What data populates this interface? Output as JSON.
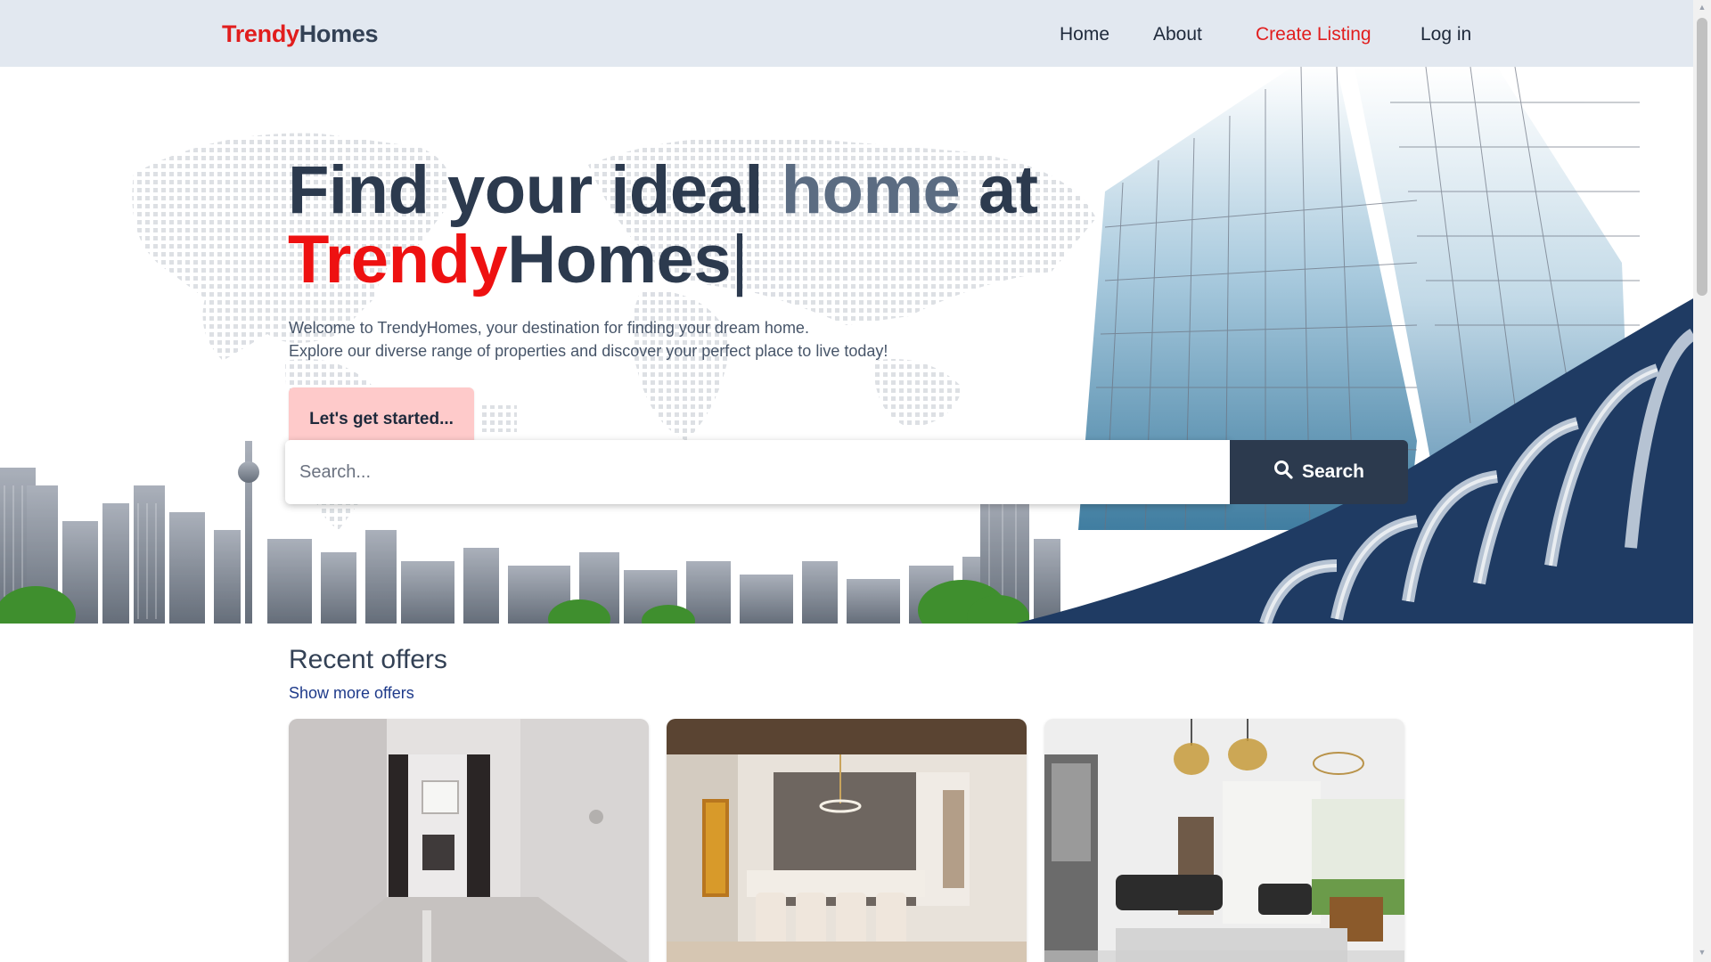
{
  "header": {
    "logo": {
      "part1": "Trendy",
      "part2": "Homes"
    },
    "nav": {
      "home": "Home",
      "about": "About",
      "create_listing": "Create Listing",
      "login": "Log in"
    }
  },
  "hero": {
    "title": {
      "line1_a": "Find your ideal ",
      "line1_b": "home",
      "line1_c": " at",
      "line2_a": "Trendy",
      "line2_b": "Homes",
      "caret": "|"
    },
    "subtitle_line1": "Welcome to TrendyHomes, your destination for finding your dream home.",
    "subtitle_line2": "Explore our diverse range of properties and discover your perfect place to live today!",
    "cta_label": "Let's get started..."
  },
  "search": {
    "placeholder": "Search...",
    "button_label": "Search",
    "icon": "search-icon"
  },
  "offers": {
    "title": "Recent offers",
    "link": "Show more offers",
    "cards": [
      {
        "image": "empty-apartment-hallway-photo"
      },
      {
        "image": "dining-room-photo"
      },
      {
        "image": "living-room-with-chandeliers-photo"
      }
    ]
  },
  "colors": {
    "brand_red": "#e11d1d",
    "navy": "#2c3a4e",
    "header_bg": "#e2e8f0",
    "cta_bg": "#fecaca"
  }
}
